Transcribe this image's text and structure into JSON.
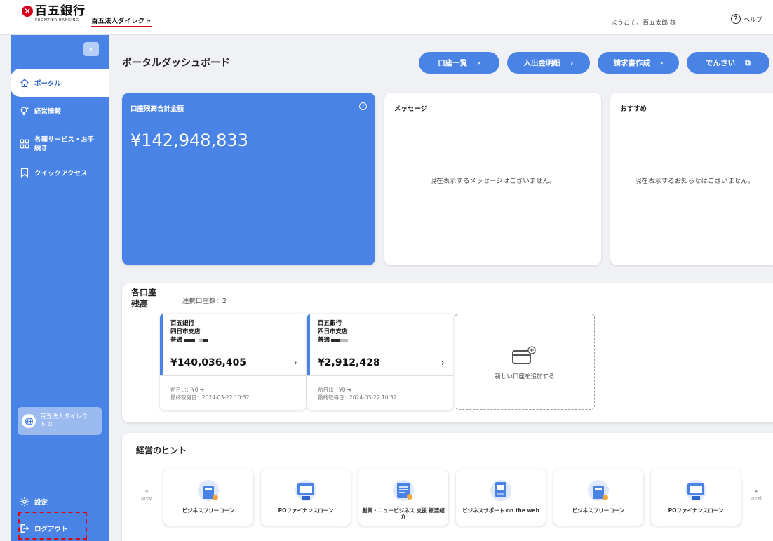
{
  "header": {
    "logo_mark": "✕",
    "bank_name": "百五銀行",
    "bank_sub": "FRONTIER BANKING",
    "product": "百五法人ダイレクト",
    "welcome": "ようこそ、百五太郎 様",
    "help_label": "ヘルプ"
  },
  "sidebar": {
    "collapse_icon": "‹",
    "items": [
      {
        "label": "ポータル",
        "icon": "home-icon"
      },
      {
        "label": "経営情報",
        "icon": "bulb-icon"
      },
      {
        "label": "各種サービス・お手続き",
        "icon": "grid-icon"
      },
      {
        "label": "クイックアクセス",
        "icon": "bookmark-icon"
      }
    ],
    "direct_link": "百五法人ダイレクト",
    "settings": "設定",
    "logout": "ログアウト"
  },
  "main": {
    "title": "ポータルダッシュボード",
    "actions": [
      "口座一覧",
      "入出金明細",
      "請求書作成",
      "でんさい"
    ],
    "balance": {
      "label": "口座残高合計金額",
      "amount": "¥142,948,833"
    },
    "messages": {
      "title": "メッセージ",
      "empty": "現在表示するメッセージはございません。"
    },
    "recommend": {
      "title": "おすすめ",
      "empty": "現在表示するお知らせはございません。"
    },
    "accounts": {
      "title": "各口座残高",
      "linked": "連携口座数：2",
      "items": [
        {
          "bank": "百五銀行",
          "branch": "四日市支店",
          "type": "普通",
          "amount": "¥140,036,405",
          "diff": "前日比：¥0 ➜",
          "updated": "最終取得日：2024-03-22 10:32"
        },
        {
          "bank": "百五銀行",
          "branch": "四日市支店",
          "type": "普通",
          "amount": "¥2,912,428",
          "diff": "前日比：¥0 ➜",
          "updated": "最終取得日：2024-03-22 10:32"
        }
      ],
      "add_label": "新しい口座を追加する"
    },
    "hints": {
      "title": "経営のヒント",
      "prev": "prev",
      "next": "next",
      "items": [
        "ビジネスフリーローン",
        "POファイナンスローン",
        "創業・ニュービジネス 支援 概要紹介",
        "ビジネスサポート on the web",
        "ビジネスフリーローン",
        "POファイナンスローン"
      ]
    }
  },
  "colors": {
    "accent": "#4a83e6",
    "brand_red": "#d7001c",
    "highlight": "#e0000f"
  }
}
